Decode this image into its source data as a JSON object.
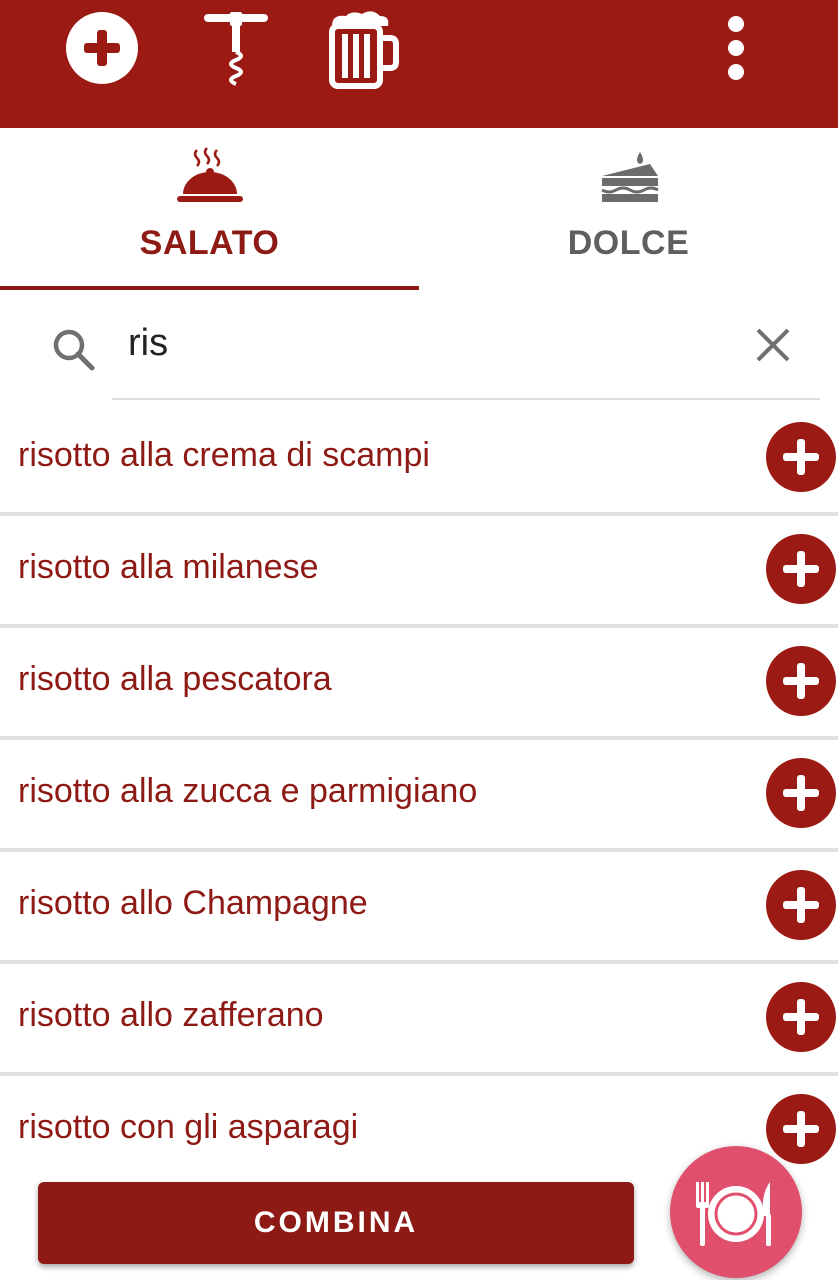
{
  "toolbar": {
    "background_color": "#9b1b14",
    "icons": [
      "add-circle-icon",
      "corkscrew-icon",
      "beer-mug-icon",
      "more-vert-icon"
    ]
  },
  "tabs": [
    {
      "label": "SALATO",
      "icon": "cloche-icon",
      "selected": true
    },
    {
      "label": "DOLCE",
      "icon": "cake-icon",
      "selected": false
    }
  ],
  "search": {
    "value": "ris",
    "icon": "search-icon",
    "clear_icon": "close-icon"
  },
  "results": [
    {
      "label": "risotto alla crema di scampi"
    },
    {
      "label": "risotto alla milanese"
    },
    {
      "label": "risotto alla pescatora"
    },
    {
      "label": "risotto alla zucca e parmigiano"
    },
    {
      "label": "risotto allo Champagne"
    },
    {
      "label": "risotto allo zafferano"
    },
    {
      "label": "risotto con gli asparagi"
    }
  ],
  "combina_button": {
    "label": "COMBINA"
  },
  "fab": {
    "icon": "plate-fork-knife-icon"
  },
  "colors": {
    "accent": "#8e1a15",
    "fab": "#e0506d",
    "tab_inactive": "#5f5f5f"
  }
}
